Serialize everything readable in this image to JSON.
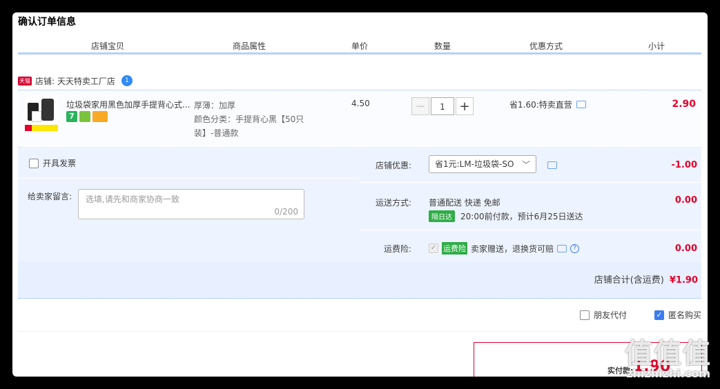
{
  "page_title": "确认订单信息",
  "columns": [
    "店铺宝贝",
    "商品属性",
    "单价",
    "数量",
    "优惠方式",
    "小计"
  ],
  "shop": {
    "badge": "天猫",
    "label": "店铺: 天天特卖工厂店",
    "wang": "1"
  },
  "item": {
    "title": "垃圾袋家用黑色加厚手提背心式...",
    "badge_seven": "7",
    "attr_line1": "厚薄：加厚",
    "attr_line2": "颜色分类：手提背心黑【50只",
    "attr_line3": "装】-普通款",
    "price": "4.50",
    "qty": "1",
    "minus": "−",
    "plus": "+",
    "discount": "省1.60:特卖直营",
    "subtotal": "2.90"
  },
  "invoice_label": "开具发票",
  "message": {
    "label": "给卖家留言:",
    "placeholder": "选填,请先和商家协商一致",
    "counter": "0/200"
  },
  "shop_discount": {
    "label": "店铺优惠:",
    "selected": "省1元:LM-垃圾袋-SO",
    "amount": "-1.00"
  },
  "shipping": {
    "label": "运送方式:",
    "method": "普通配送 快递 免邮",
    "badge": "隔日达",
    "eta": "20:00前付款，预计6月25日送达",
    "amount": "0.00"
  },
  "insurance": {
    "label": "运费险:",
    "badge": "运费险",
    "text": "卖家赠送，退换货可赔",
    "amount": "0.00"
  },
  "shop_total": {
    "label": "店铺合计(含运费)",
    "amount": "¥1.90"
  },
  "friend_pay": "朋友代付",
  "anonymous": "匿名购买",
  "pay": {
    "label": "实付款:",
    "amount": "1.90"
  },
  "watermark": {
    "big": "值值值",
    "small": "zhizhizhi.com"
  }
}
